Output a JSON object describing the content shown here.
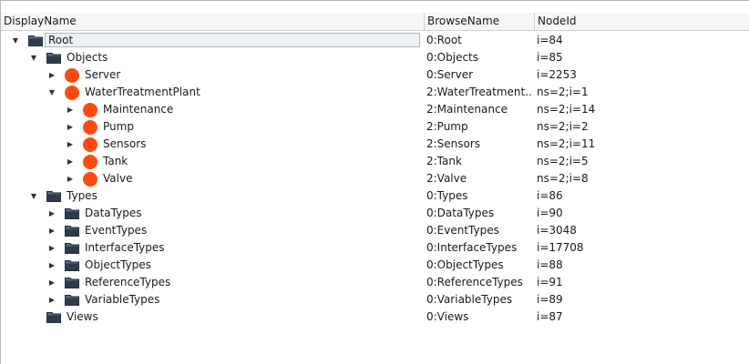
{
  "columns": {
    "display_name": "DisplayName",
    "browse_name": "BrowseName",
    "node_id": "NodeId"
  },
  "colors": {
    "object_icon": "#ff4a0f",
    "folder_icon": "#2f3b4d",
    "selection_border": "#aab7c8"
  },
  "rows": [
    {
      "depth": 0,
      "arrow": "expanded",
      "icon": "folder-icon",
      "display": "Root",
      "browse": "0:Root",
      "node": "i=84"
    },
    {
      "depth": 1,
      "arrow": "expanded",
      "icon": "folder-icon",
      "display": "Objects",
      "browse": "0:Objects",
      "node": "i=85"
    },
    {
      "depth": 2,
      "arrow": "collapsed",
      "icon": "object-icon",
      "display": "Server",
      "browse": "0:Server",
      "node": "i=2253"
    },
    {
      "depth": 2,
      "arrow": "expanded",
      "icon": "object-icon",
      "display": "WaterTreatmentPlant",
      "browse": "2:WaterTreatment...",
      "node": "ns=2;i=1"
    },
    {
      "depth": 3,
      "arrow": "collapsed",
      "icon": "object-icon",
      "display": "Maintenance",
      "browse": "2:Maintenance",
      "node": "ns=2;i=14"
    },
    {
      "depth": 3,
      "arrow": "collapsed",
      "icon": "object-icon",
      "display": "Pump",
      "browse": "2:Pump",
      "node": "ns=2;i=2"
    },
    {
      "depth": 3,
      "arrow": "collapsed",
      "icon": "object-icon",
      "display": "Sensors",
      "browse": "2:Sensors",
      "node": "ns=2;i=11"
    },
    {
      "depth": 3,
      "arrow": "collapsed",
      "icon": "object-icon",
      "display": "Tank",
      "browse": "2:Tank",
      "node": "ns=2;i=5"
    },
    {
      "depth": 3,
      "arrow": "collapsed",
      "icon": "object-icon",
      "display": "Valve",
      "browse": "2:Valve",
      "node": "ns=2;i=8"
    },
    {
      "depth": 1,
      "arrow": "expanded",
      "icon": "folder-icon",
      "display": "Types",
      "browse": "0:Types",
      "node": "i=86"
    },
    {
      "depth": 2,
      "arrow": "collapsed",
      "icon": "folder-icon",
      "display": "DataTypes",
      "browse": "0:DataTypes",
      "node": "i=90"
    },
    {
      "depth": 2,
      "arrow": "collapsed",
      "icon": "folder-icon",
      "display": "EventTypes",
      "browse": "0:EventTypes",
      "node": "i=3048"
    },
    {
      "depth": 2,
      "arrow": "collapsed",
      "icon": "folder-icon",
      "display": "InterfaceTypes",
      "browse": "0:InterfaceTypes",
      "node": "i=17708"
    },
    {
      "depth": 2,
      "arrow": "collapsed",
      "icon": "folder-icon",
      "display": "ObjectTypes",
      "browse": "0:ObjectTypes",
      "node": "i=88"
    },
    {
      "depth": 2,
      "arrow": "collapsed",
      "icon": "folder-icon",
      "display": "ReferenceTypes",
      "browse": "0:ReferenceTypes",
      "node": "i=91"
    },
    {
      "depth": 2,
      "arrow": "collapsed",
      "icon": "folder-icon",
      "display": "VariableTypes",
      "browse": "0:VariableTypes",
      "node": "i=89"
    },
    {
      "depth": 1,
      "arrow": "none",
      "icon": "folder-icon",
      "display": "Views",
      "browse": "0:Views",
      "node": "i=87"
    }
  ]
}
